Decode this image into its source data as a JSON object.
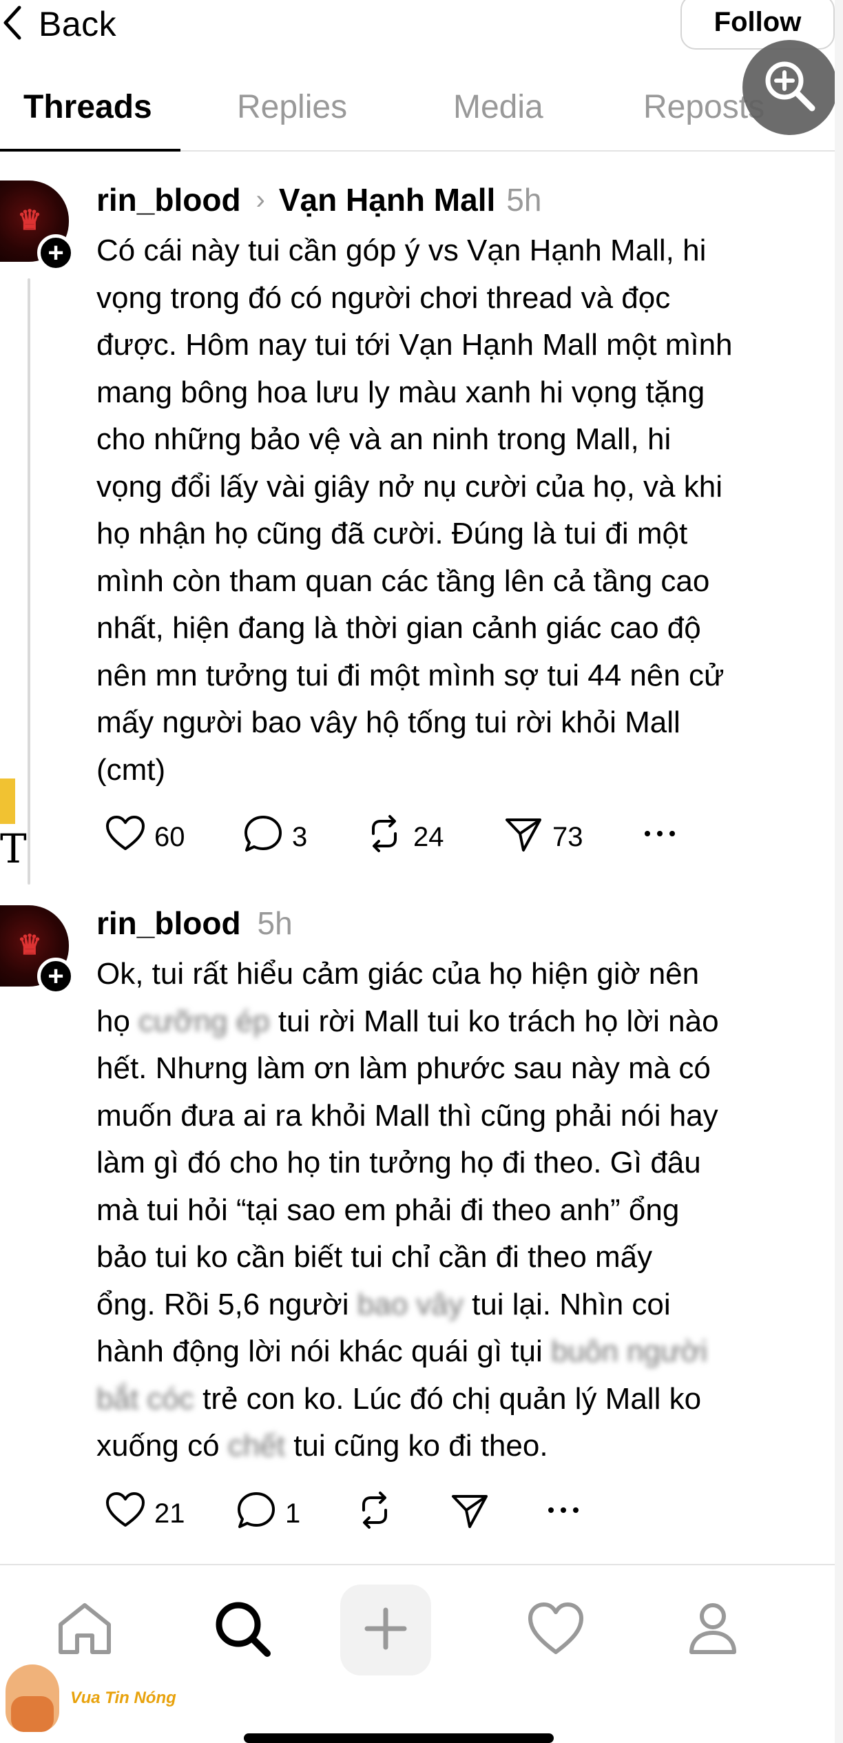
{
  "topbar": {
    "back_label": "Back",
    "follow_label": "Follow"
  },
  "tabs": [
    {
      "label": "Threads",
      "active": true
    },
    {
      "label": "Replies",
      "active": false
    },
    {
      "label": "Media",
      "active": false
    },
    {
      "label": "Reposts",
      "active": false
    }
  ],
  "posts": [
    {
      "username": "rin_blood",
      "community": "Vạn Hạnh Mall",
      "time": "5h",
      "lines": [
        "Có cái này tui cần góp ý vs Vạn Hạnh Mall, hi",
        "vọng trong đó có người chơi thread và đọc",
        "được. Hôm nay tui tới Vạn Hạnh Mall một mình",
        "mang bông hoa lưu ly màu xanh hi vọng tặng",
        "cho những bảo vệ và an ninh trong Mall, hi",
        "vọng đổi lấy vài giây nở nụ cười của họ, và khi",
        "họ nhận họ cũng đã cười. Đúng là tui đi một",
        "mình còn tham quan các tầng lên cả tầng cao",
        "nhất, hiện đang là thời gian cảnh giác cao độ",
        "nên mn tưởng tui đi một mình sợ tui 44 nên cử",
        "mấy người bao vây hộ tống tui rời khỏi Mall",
        "(cmt)"
      ],
      "likes": "60",
      "comments": "3",
      "reposts": "24",
      "shares": "73"
    },
    {
      "username": "rin_blood",
      "time": "5h",
      "lines": {
        "l1": "Ok, tui rất hiểu cảm giác của họ hiện giờ nên",
        "l2a": "họ ",
        "l2b": "cưỡng ép",
        "l2c": " tui rời Mall tui ko trách họ lời nào",
        "l3": "hết. Nhưng làm ơn làm phước sau này mà có",
        "l4": "muốn đưa ai ra khỏi Mall thì cũng phải nói hay",
        "l5": "làm gì đó cho họ tin tưởng họ đi theo. Gì đâu",
        "l6": "mà tui hỏi “tại sao em phải đi theo anh” ổng",
        "l7": "bảo tui ko cần biết tui chỉ cần đi theo mấy",
        "l8a": "ổng. Rồi 5,6 người ",
        "l8b": "bao vây",
        "l8c": " tui lại. Nhìn coi",
        "l9a": "hành động lời nói khác quái gì tụi ",
        "l9b": "buôn người",
        "l10a": "bắt cóc",
        "l10b": " trẻ con ko. Lúc đó chị quản lý Mall ko",
        "l11a": "xuống có ",
        "l11b": "chết",
        "l11c": " tui cũng ko đi theo."
      },
      "likes": "21",
      "comments": "1"
    }
  ],
  "watermark": "Vua Tin Nóng",
  "icons": [
    "chevron-left-icon",
    "zoom-in-icon",
    "heart-icon",
    "comment-icon",
    "repost-icon",
    "share-icon",
    "more-icon",
    "home-icon",
    "search-icon",
    "plus-icon",
    "activity-icon",
    "profile-icon"
  ]
}
